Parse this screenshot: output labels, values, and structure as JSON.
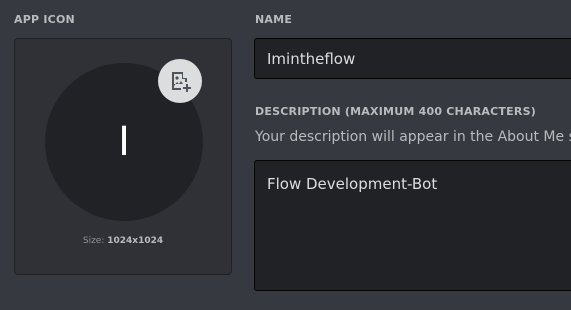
{
  "app_icon": {
    "label": "APP ICON",
    "avatar_letter": "I",
    "size_prefix": "Size: ",
    "size_value": "1024x1024",
    "upload_icon": "image-plus-icon"
  },
  "name": {
    "label": "NAME",
    "value": "Imintheflow"
  },
  "description": {
    "label": "DESCRIPTION (MAXIMUM 400 CHARACTERS)",
    "hint": "Your description will appear in the About Me section",
    "value": "Flow Development-Bot"
  },
  "colors": {
    "background": "#36393f",
    "card": "#2f3136",
    "input": "#202225",
    "label": "#b9bbbe"
  }
}
